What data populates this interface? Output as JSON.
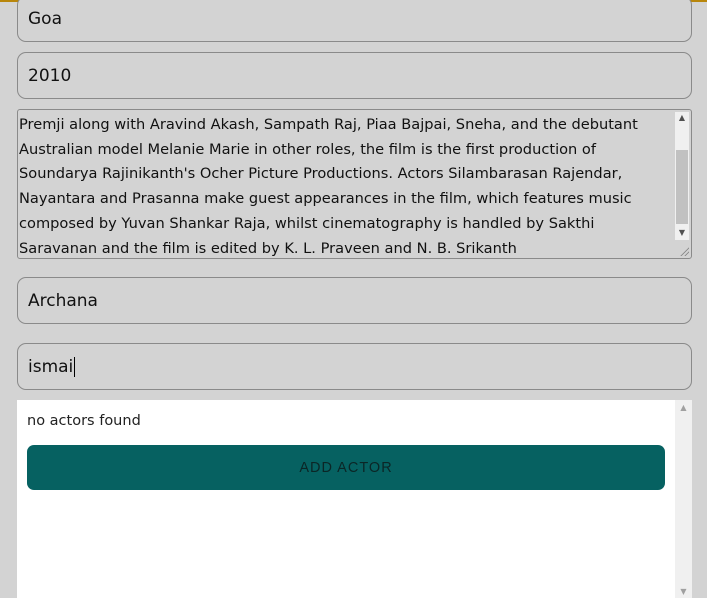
{
  "form": {
    "location": "Goa",
    "year": "2010",
    "description": "Premji along with Aravind Akash, Sampath Raj, Piaa Bajpai, Sneha, and the debutant Australian model Melanie Marie in other roles, the film is the first production of Soundarya Rajinikanth's Ocher Picture Productions. Actors Silambarasan Rajendar, Nayantara and Prasanna make guest appearances in the film, which features music composed by Yuvan Shankar Raja, whilst cinematography is handled by Sakthi Saravanan and the film is edited by K. L. Praveen and N. B. Srikanth",
    "heroine": "Archana",
    "actor_search": "ismai"
  },
  "results": {
    "message": "no actors found",
    "add_actor_label": "ADD ACTOR"
  },
  "colors": {
    "accent": "#b8860b",
    "button": "#066161"
  }
}
